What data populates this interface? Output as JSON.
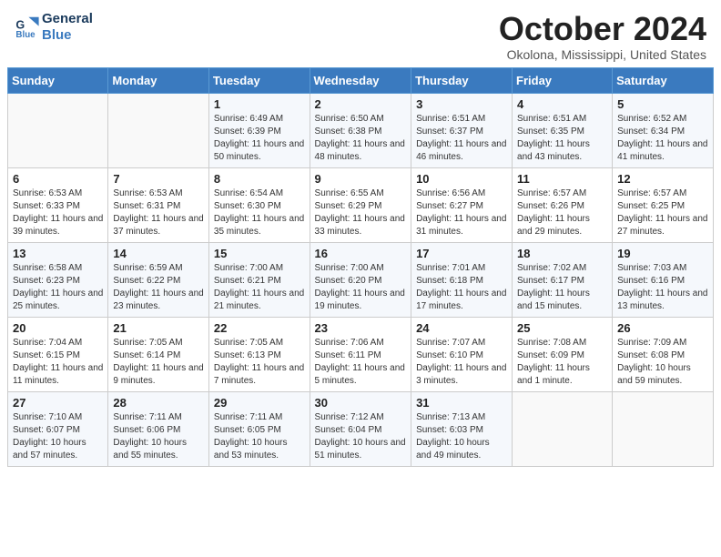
{
  "header": {
    "logo_line1": "General",
    "logo_line2": "Blue",
    "month_title": "October 2024",
    "location": "Okolona, Mississippi, United States"
  },
  "weekdays": [
    "Sunday",
    "Monday",
    "Tuesday",
    "Wednesday",
    "Thursday",
    "Friday",
    "Saturday"
  ],
  "weeks": [
    [
      {
        "day": "",
        "info": ""
      },
      {
        "day": "",
        "info": ""
      },
      {
        "day": "1",
        "info": "Sunrise: 6:49 AM\nSunset: 6:39 PM\nDaylight: 11 hours and 50 minutes."
      },
      {
        "day": "2",
        "info": "Sunrise: 6:50 AM\nSunset: 6:38 PM\nDaylight: 11 hours and 48 minutes."
      },
      {
        "day": "3",
        "info": "Sunrise: 6:51 AM\nSunset: 6:37 PM\nDaylight: 11 hours and 46 minutes."
      },
      {
        "day": "4",
        "info": "Sunrise: 6:51 AM\nSunset: 6:35 PM\nDaylight: 11 hours and 43 minutes."
      },
      {
        "day": "5",
        "info": "Sunrise: 6:52 AM\nSunset: 6:34 PM\nDaylight: 11 hours and 41 minutes."
      }
    ],
    [
      {
        "day": "6",
        "info": "Sunrise: 6:53 AM\nSunset: 6:33 PM\nDaylight: 11 hours and 39 minutes."
      },
      {
        "day": "7",
        "info": "Sunrise: 6:53 AM\nSunset: 6:31 PM\nDaylight: 11 hours and 37 minutes."
      },
      {
        "day": "8",
        "info": "Sunrise: 6:54 AM\nSunset: 6:30 PM\nDaylight: 11 hours and 35 minutes."
      },
      {
        "day": "9",
        "info": "Sunrise: 6:55 AM\nSunset: 6:29 PM\nDaylight: 11 hours and 33 minutes."
      },
      {
        "day": "10",
        "info": "Sunrise: 6:56 AM\nSunset: 6:27 PM\nDaylight: 11 hours and 31 minutes."
      },
      {
        "day": "11",
        "info": "Sunrise: 6:57 AM\nSunset: 6:26 PM\nDaylight: 11 hours and 29 minutes."
      },
      {
        "day": "12",
        "info": "Sunrise: 6:57 AM\nSunset: 6:25 PM\nDaylight: 11 hours and 27 minutes."
      }
    ],
    [
      {
        "day": "13",
        "info": "Sunrise: 6:58 AM\nSunset: 6:23 PM\nDaylight: 11 hours and 25 minutes."
      },
      {
        "day": "14",
        "info": "Sunrise: 6:59 AM\nSunset: 6:22 PM\nDaylight: 11 hours and 23 minutes."
      },
      {
        "day": "15",
        "info": "Sunrise: 7:00 AM\nSunset: 6:21 PM\nDaylight: 11 hours and 21 minutes."
      },
      {
        "day": "16",
        "info": "Sunrise: 7:00 AM\nSunset: 6:20 PM\nDaylight: 11 hours and 19 minutes."
      },
      {
        "day": "17",
        "info": "Sunrise: 7:01 AM\nSunset: 6:18 PM\nDaylight: 11 hours and 17 minutes."
      },
      {
        "day": "18",
        "info": "Sunrise: 7:02 AM\nSunset: 6:17 PM\nDaylight: 11 hours and 15 minutes."
      },
      {
        "day": "19",
        "info": "Sunrise: 7:03 AM\nSunset: 6:16 PM\nDaylight: 11 hours and 13 minutes."
      }
    ],
    [
      {
        "day": "20",
        "info": "Sunrise: 7:04 AM\nSunset: 6:15 PM\nDaylight: 11 hours and 11 minutes."
      },
      {
        "day": "21",
        "info": "Sunrise: 7:05 AM\nSunset: 6:14 PM\nDaylight: 11 hours and 9 minutes."
      },
      {
        "day": "22",
        "info": "Sunrise: 7:05 AM\nSunset: 6:13 PM\nDaylight: 11 hours and 7 minutes."
      },
      {
        "day": "23",
        "info": "Sunrise: 7:06 AM\nSunset: 6:11 PM\nDaylight: 11 hours and 5 minutes."
      },
      {
        "day": "24",
        "info": "Sunrise: 7:07 AM\nSunset: 6:10 PM\nDaylight: 11 hours and 3 minutes."
      },
      {
        "day": "25",
        "info": "Sunrise: 7:08 AM\nSunset: 6:09 PM\nDaylight: 11 hours and 1 minute."
      },
      {
        "day": "26",
        "info": "Sunrise: 7:09 AM\nSunset: 6:08 PM\nDaylight: 10 hours and 59 minutes."
      }
    ],
    [
      {
        "day": "27",
        "info": "Sunrise: 7:10 AM\nSunset: 6:07 PM\nDaylight: 10 hours and 57 minutes."
      },
      {
        "day": "28",
        "info": "Sunrise: 7:11 AM\nSunset: 6:06 PM\nDaylight: 10 hours and 55 minutes."
      },
      {
        "day": "29",
        "info": "Sunrise: 7:11 AM\nSunset: 6:05 PM\nDaylight: 10 hours and 53 minutes."
      },
      {
        "day": "30",
        "info": "Sunrise: 7:12 AM\nSunset: 6:04 PM\nDaylight: 10 hours and 51 minutes."
      },
      {
        "day": "31",
        "info": "Sunrise: 7:13 AM\nSunset: 6:03 PM\nDaylight: 10 hours and 49 minutes."
      },
      {
        "day": "",
        "info": ""
      },
      {
        "day": "",
        "info": ""
      }
    ]
  ]
}
